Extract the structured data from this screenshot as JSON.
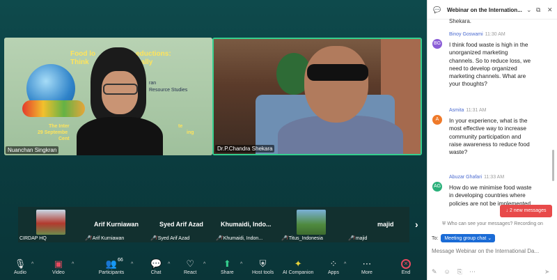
{
  "videos": {
    "nuanchan": {
      "name": "Nuanchan Singkran",
      "slide": {
        "title_line1": "Food lo",
        "title_line1b": "eductions:",
        "title_line2": "Think",
        "title_line2b": "ally",
        "line_ran": "ran",
        "line_resource": "Resource Studies",
        "line_inter": "The Inter",
        "line_te": "te",
        "line_sept": "29 Septembe",
        "line_ing": "ing",
        "line_cent": "Cent"
      }
    },
    "chandra": {
      "name": "Dr.P.Chandra Shekara"
    }
  },
  "strip": {
    "items": [
      {
        "label": "CIRDAP HQ",
        "big": ""
      },
      {
        "label": "Arif Kurniawan",
        "big": "Arif Kurniawan"
      },
      {
        "label": "Syed Arif Azad",
        "big": "Syed Arif Azad"
      },
      {
        "label": "Khumaidi, Indon...",
        "big": "Khumaidi,  Indo..."
      },
      {
        "label": "Titus_Indonesia",
        "big": ""
      },
      {
        "label": "majid",
        "big": "majid"
      }
    ],
    "next_arrow": "›"
  },
  "toolbar": {
    "audio": "Audio",
    "video": "Video",
    "participants": "Participants",
    "participants_count": "66",
    "chat": "Chat",
    "react": "React",
    "share": "Share",
    "host_tools": "Host tools",
    "ai_companion": "AI Companion",
    "apps": "Apps",
    "more": "More",
    "end": "End"
  },
  "chat": {
    "title": "Webinar on the Internation...",
    "prev_text": "Shekara.",
    "messages": [
      {
        "initials": "BG",
        "color": "#8a5cd6",
        "sender": "Binoy Goswami",
        "time": "11:30 AM",
        "text": "I think food waste is high in the unorganized marketing channels. So to reduce loss, we need to develop organized marketing channels. What are your thoughts?"
      },
      {
        "initials": "A",
        "color": "#ef7a2a",
        "sender": "Asmita",
        "time": "11:31 AM",
        "text": "In your experience, what is the most effective way to increase community participation and raise awareness to reduce food waste?"
      },
      {
        "initials": "AG",
        "color": "#2ab07a",
        "sender": "Abuzar Ghafari",
        "time": "11:33 AM",
        "text": "How do we minimise food waste in developing countries where policies are not be implemented"
      }
    ],
    "new_messages": "↓ 2 new messages",
    "who_can_see": "Who can see your messages? Recording on",
    "to_label": "To:",
    "to_value": "Meeting group chat ⌄",
    "input_placeholder": "Message Webinar on the International Da..."
  }
}
